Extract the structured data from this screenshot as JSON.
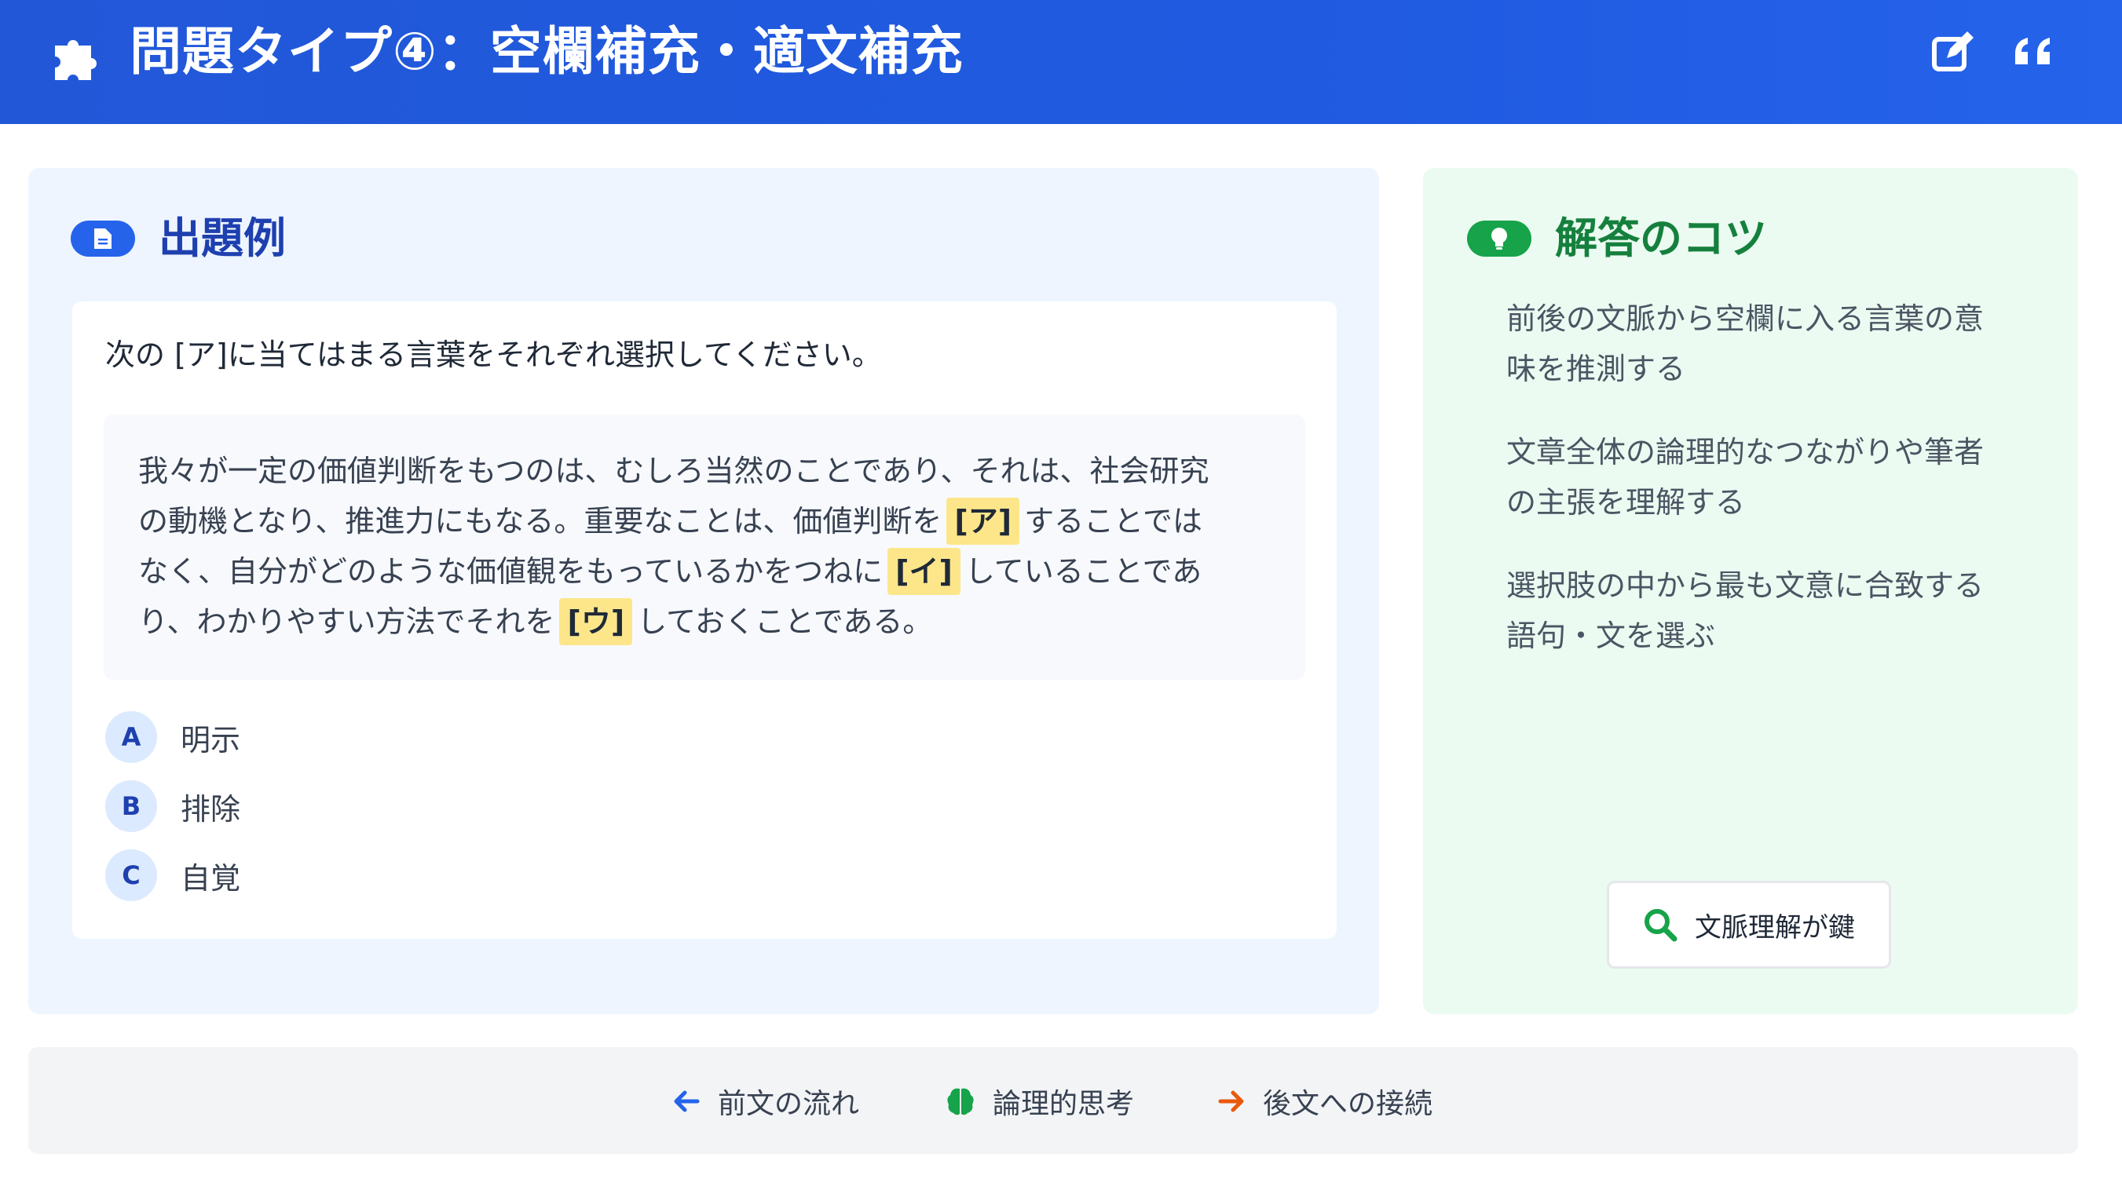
{
  "header": {
    "title": "問題タイプ④：空欄補充・適文補充",
    "icons": [
      "puzzle-icon",
      "edit-icon",
      "quote-icon"
    ]
  },
  "example": {
    "title": "出題例",
    "instruction": "次の [ア]に当てはまる言葉をそれぞれ選択してください。",
    "passage": {
      "line1": "我々が一定の価値判断をもつのは、むしろ当然のことであり、それは、社会研究",
      "line2_a": "の動機となり、推進力にもなる。重要なことは、価値判断を",
      "blank_a": "[ア]",
      "line2_b": "することでは",
      "line3_a": "なく、自分がどのような価値観をもっているかをつねに",
      "blank_i": "[イ]",
      "line3_b": "していることであ",
      "line4_a": "り、わかりやすい方法でそれを",
      "blank_u": "[ウ]",
      "line4_b": "しておくことである。"
    },
    "options": [
      {
        "key": "A",
        "text": "明示"
      },
      {
        "key": "B",
        "text": "排除"
      },
      {
        "key": "C",
        "text": "自覚"
      }
    ]
  },
  "tips": {
    "title": "解答のコツ",
    "items": [
      {
        "line1": "前後の文脈から空欄に入る言葉の意",
        "line2": "味を推測する"
      },
      {
        "line1": "文章全体の論理的なつながりや筆者",
        "line2": "の主張を理解する"
      },
      {
        "line1": "選択肢の中から最も文意に合致する",
        "line2": "語句・文を選ぶ"
      }
    ],
    "key_button": "文脈理解が鍵"
  },
  "footer": {
    "items": [
      {
        "label": "前文の流れ",
        "icon": "arrow-left-icon"
      },
      {
        "label": "論理的思考",
        "icon": "brain-icon"
      },
      {
        "label": "後文への接続",
        "icon": "arrow-right-icon"
      }
    ]
  },
  "colors": {
    "header_bg": "#2258d8",
    "accent_blue": "#1e40af",
    "accent_green": "#15803d",
    "highlight": "#fde68a",
    "footer_arrow_right": "#ea580c"
  }
}
